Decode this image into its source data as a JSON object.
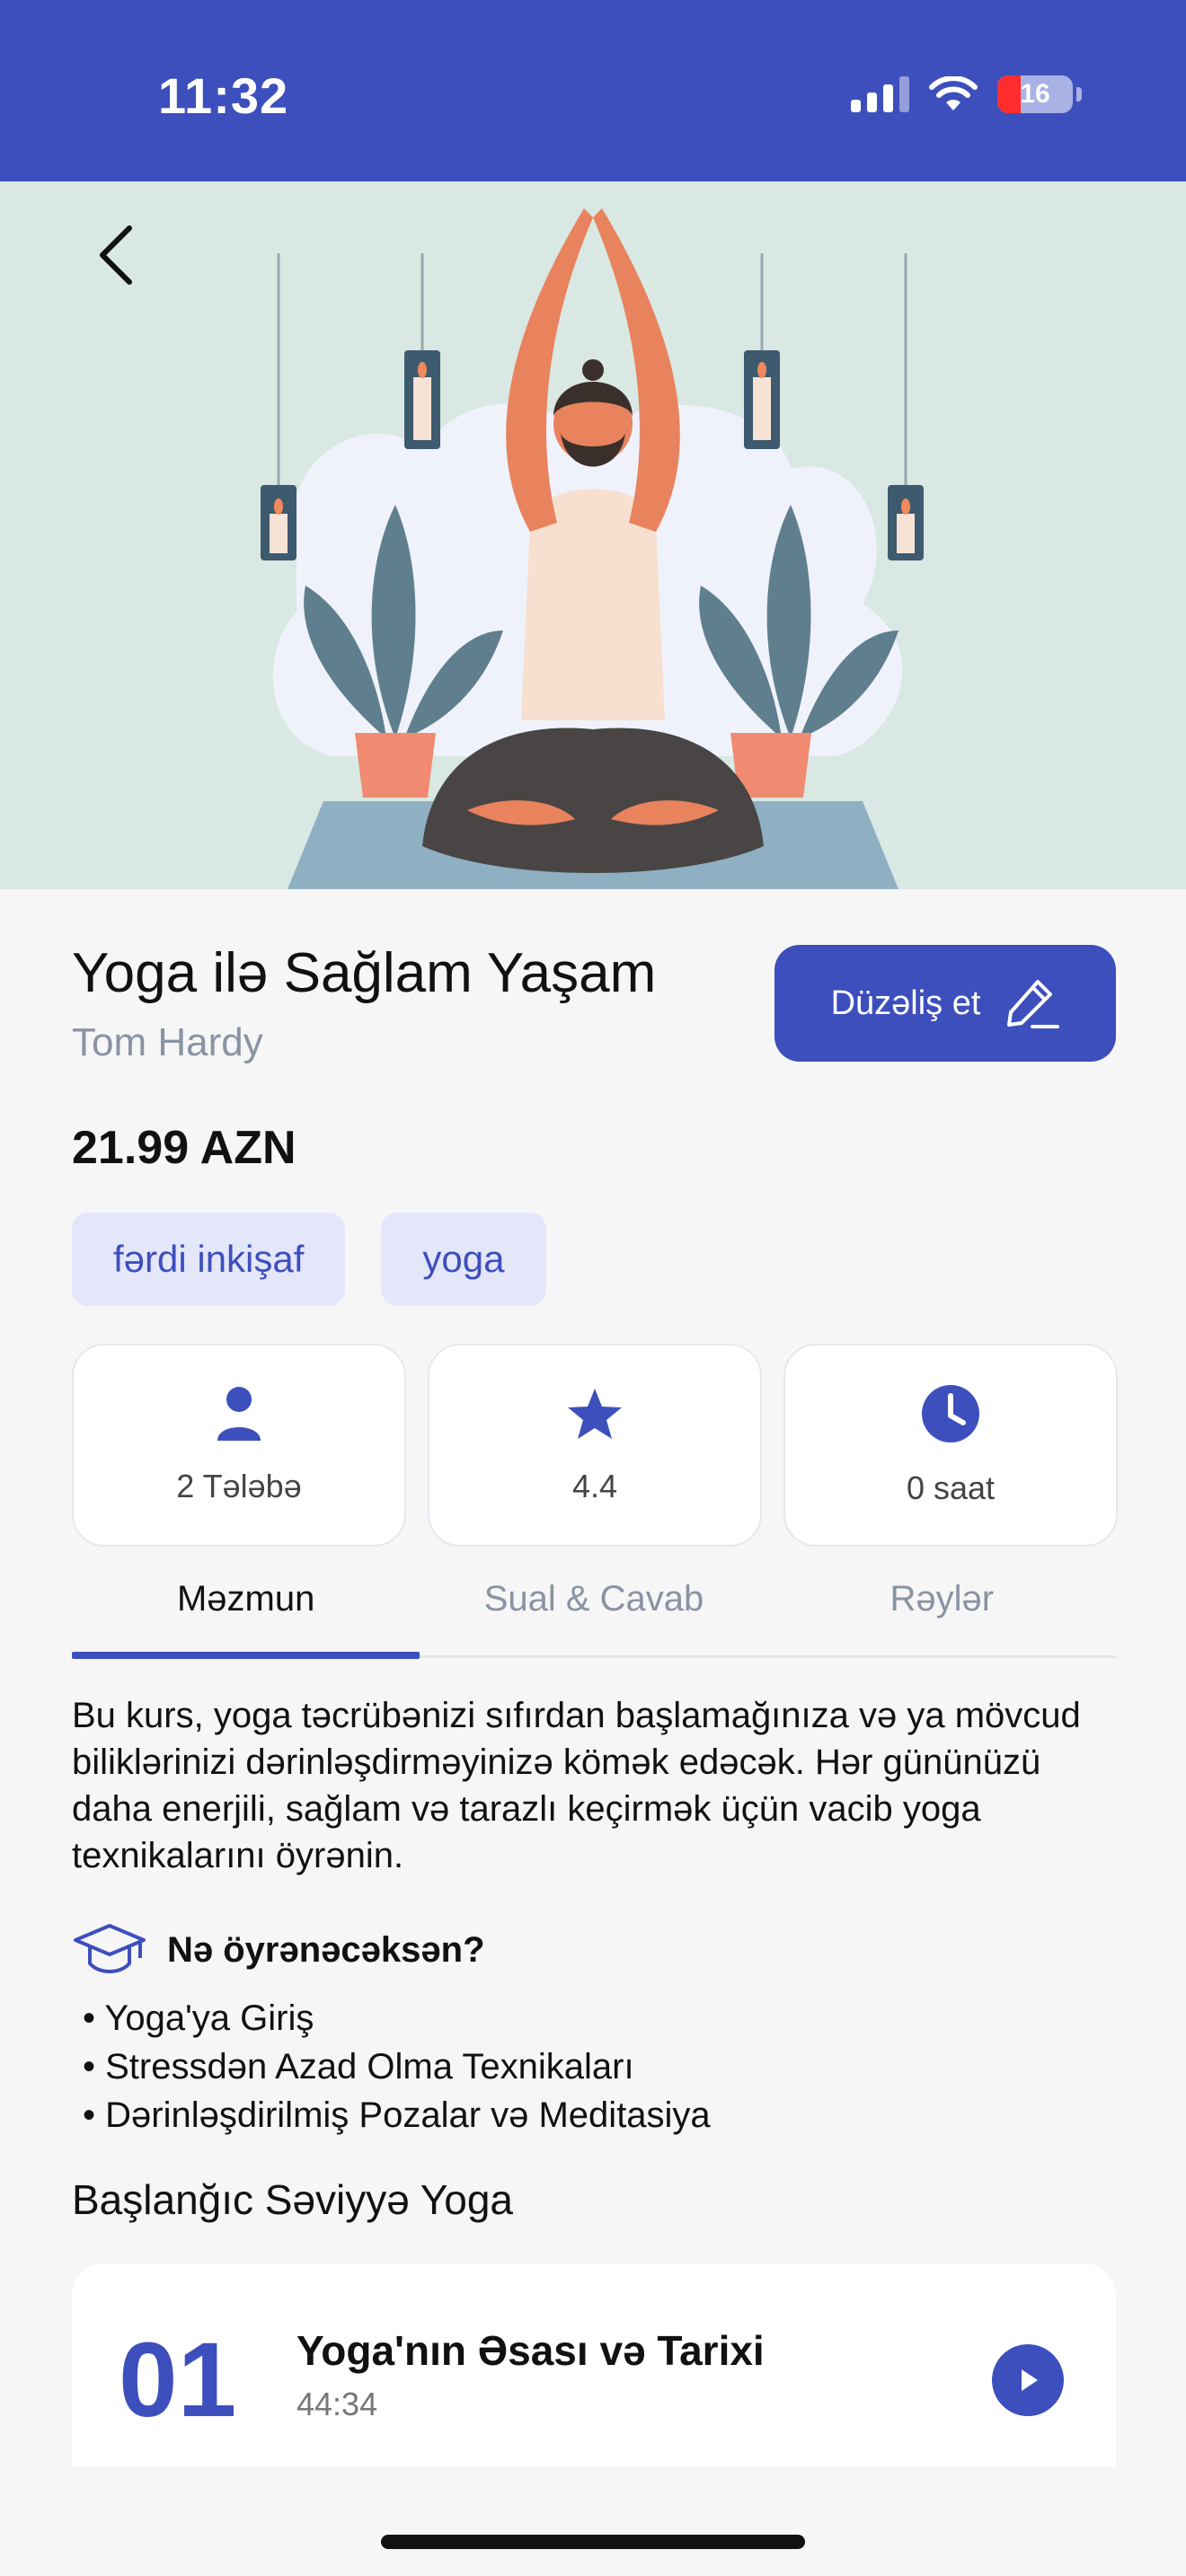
{
  "status_bar": {
    "time": "11:32",
    "battery": "16"
  },
  "course": {
    "title": "Yoga ilə Sağlam Yaşam",
    "instructor": "Tom Hardy",
    "price": "21.99 AZN",
    "edit_label": "Düzəliş et",
    "tags": [
      "fərdi inkişaf",
      "yoga"
    ]
  },
  "stats": [
    {
      "icon": "person-icon",
      "value": "2 Tələbə"
    },
    {
      "icon": "star-icon",
      "value": "4.4"
    },
    {
      "icon": "clock-icon",
      "value": "0 saat"
    }
  ],
  "tabs": [
    "Məzmun",
    "Sual & Cavab",
    "Rəylər"
  ],
  "description": "Bu kurs, yoga təcrübənizi sıfırdan başlamağınıza və ya mövcud biliklərinizi dərinləşdirməyinizə kömək edəcək. Hər gününüzü daha enerjili, sağlam və tarazlı keçirmək üçün vacib yoga texnikalarını öyrənin.",
  "learn": {
    "title": "Nə öyrənəcəksən?",
    "items": [
      "Yoga'ya Giriş",
      "Stressdən Azad Olma Texnikaları",
      "Dərinləşdirilmiş Pozalar və Meditasiya"
    ]
  },
  "section": {
    "title": "Başlanğıc Səviyyə Yoga"
  },
  "lessons": [
    {
      "number": "01",
      "title": "Yoga'nın Əsası və Tarixi",
      "duration": "44:34"
    }
  ],
  "colors": {
    "primary": "#3d4fbd",
    "hero_bg": "#d9e8e2",
    "tag_bg": "#e4e6fa"
  }
}
